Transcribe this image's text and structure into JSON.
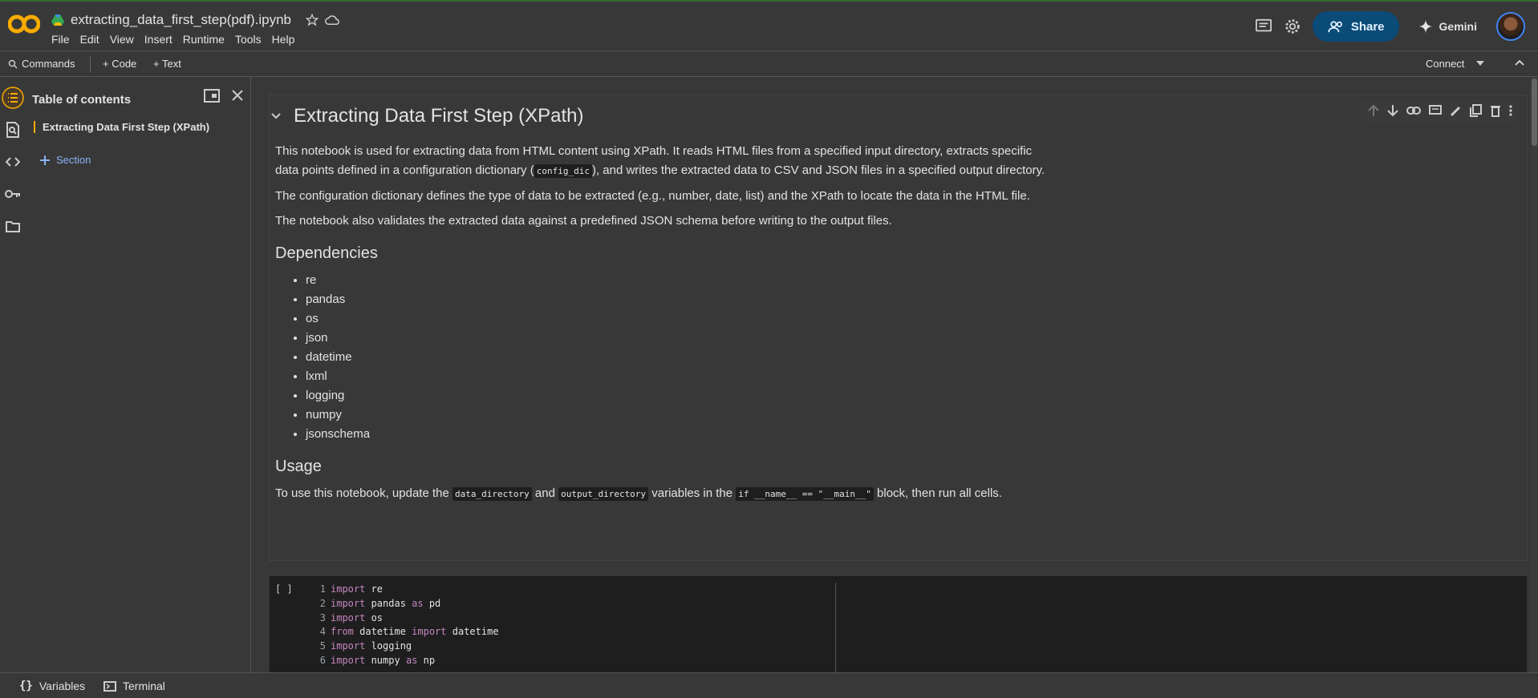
{
  "app": {
    "notebook_title": "extracting_data_first_step(pdf).ipynb",
    "menu": [
      "File",
      "Edit",
      "View",
      "Insert",
      "Runtime",
      "Tools",
      "Help"
    ],
    "share_label": "Share",
    "gemini_label": "Gemini"
  },
  "toolbar": {
    "commands": "Commands",
    "add_code": "+ Code",
    "add_text": "+ Text",
    "connect": "Connect"
  },
  "toc": {
    "title": "Table of contents",
    "items": [
      "Extracting Data First Step (XPath)"
    ],
    "section": "Section"
  },
  "cell_md": {
    "h1": "Extracting Data First Step (XPath)",
    "p1_a": "This notebook is used for extracting data from HTML content using XPath. It reads HTML files from a specified input directory, extracts specific data points defined in a configuration dictionary (",
    "p1_code": "config_dic",
    "p1_b": "), and writes the extracted data to CSV and JSON files in a specified output directory.",
    "p2": "The configuration dictionary defines the type of data to be extracted (e.g., number, date, list) and the XPath to locate the data in the HTML file.",
    "p3": "The notebook also validates the extracted data against a predefined JSON schema before writing to the output files.",
    "h2_deps": "Dependencies",
    "deps": [
      "re",
      "pandas",
      "os",
      "json",
      "datetime",
      "lxml",
      "logging",
      "numpy",
      "jsonschema"
    ],
    "h2_usage": "Usage",
    "usage_a": "To use this notebook, update the ",
    "usage_code1": "data_directory",
    "usage_b": " and ",
    "usage_code2": "output_directory",
    "usage_c": " variables in the ",
    "usage_code3": "if __name__ == \"__main__\"",
    "usage_d": " block, then run all cells."
  },
  "code_cell": {
    "run_label": "[ ]",
    "lines": [
      {
        "n": "1",
        "kw": "import",
        "rest": " re"
      },
      {
        "n": "2",
        "kw": "import",
        "rest": " pandas ",
        "kw2": "as",
        "rest2": " pd"
      },
      {
        "n": "3",
        "kw": "import",
        "rest": " os"
      },
      {
        "n": "4",
        "kw": "from",
        "rest": " datetime ",
        "kw2": "import",
        "rest2": " datetime"
      },
      {
        "n": "5",
        "kw": "import",
        "rest": " logging"
      },
      {
        "n": "6",
        "kw": "import",
        "rest": " numpy ",
        "kw2": "as",
        "rest2": " np"
      }
    ]
  },
  "bottom": {
    "variables": "Variables",
    "terminal": "Terminal"
  },
  "icons": [
    "colab-logo",
    "drive-icon",
    "star-icon",
    "cloud-icon",
    "comment-icon",
    "gear-icon",
    "people-icon",
    "sparkle-icon",
    "search-icon",
    "chevron-down-icon",
    "chevron-up-icon",
    "toc-icon",
    "find-icon",
    "code-icon",
    "key-icon",
    "folder-icon",
    "open-tab-icon",
    "close-icon",
    "arrow-up-icon",
    "arrow-down-icon",
    "link-icon",
    "edit-icon",
    "copy-icon",
    "trash-icon",
    "more-icon",
    "braces-icon",
    "terminal-icon"
  ],
  "colors": {
    "accent_orange": "#f9ab00",
    "share_bg": "#0b4b78",
    "link_blue": "#8ab4f8",
    "bg": "#383838",
    "code_bg": "#1e1e1e"
  }
}
